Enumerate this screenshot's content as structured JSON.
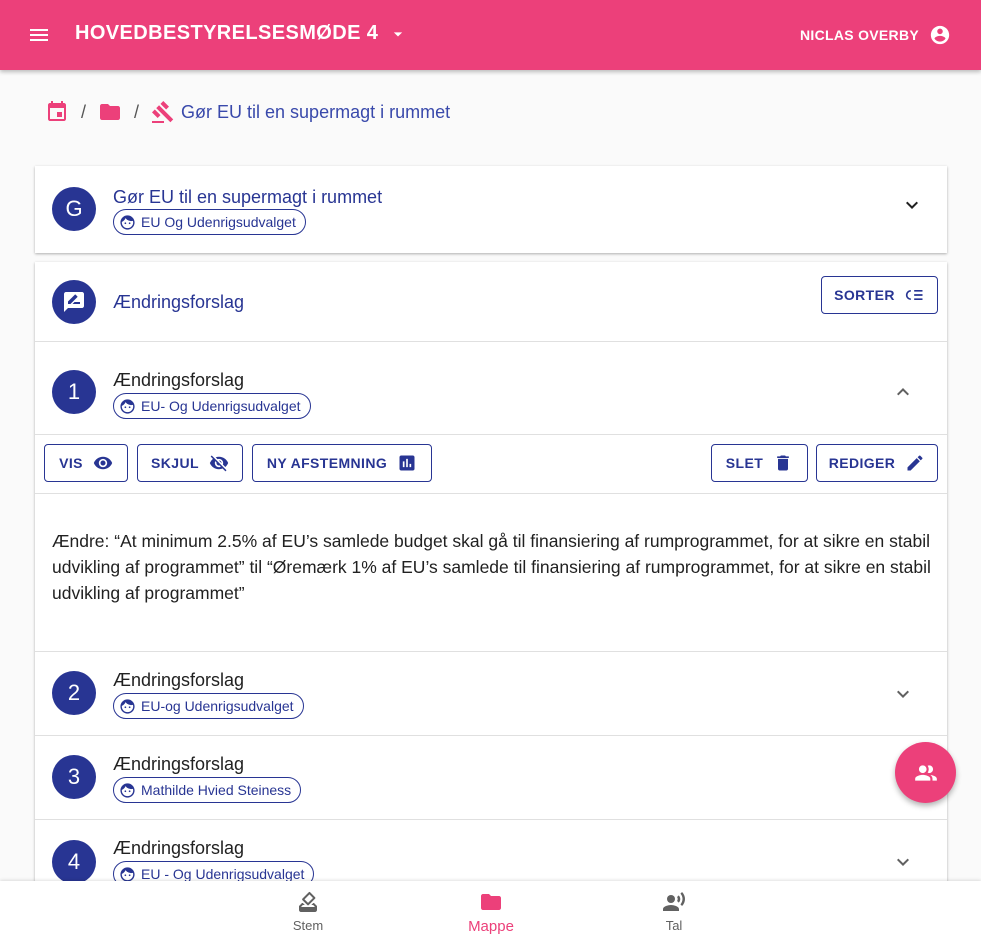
{
  "appbar": {
    "title": "HOVEDBESTYRELSESMØDE 4",
    "user": "NICLAS OVERBY"
  },
  "breadcrumb": {
    "current": "Gør EU til en supermagt i rummet"
  },
  "agenda_item": {
    "avatar_letter": "G",
    "title": "Gør EU til en supermagt i rummet",
    "proposer": "EU Og Udenrigsudvalget"
  },
  "amendments_section": {
    "title": "Ændringsforslag",
    "sort_label": "SORTER"
  },
  "amendments": [
    {
      "number": "1",
      "title": "Ændringsforslag",
      "proposer": "EU- Og Udenrigsudvalget",
      "expanded": true,
      "actions": {
        "show": "VIS",
        "hide": "SKJUL",
        "new_vote": "NY AFSTEMNING",
        "delete": "SLET",
        "edit": "REDIGER"
      },
      "text": "Ændre: “At minimum 2.5% af EU’s samlede budget skal gå til finansiering af rumprogrammet, for at sikre en stabil udvikling af programmet” til “Øremærk 1% af EU’s samlede til finansiering af rumprogrammet, for at sikre en stabil udvikling af programmet”"
    },
    {
      "number": "2",
      "title": "Ændringsforslag",
      "proposer": "EU-og Udenrigsudvalget"
    },
    {
      "number": "3",
      "title": "Ændringsforslag",
      "proposer": "Mathilde Hvied Steiness"
    },
    {
      "number": "4",
      "title": "Ændringsforslag",
      "proposer": "EU - Og Udenrigsudvalget"
    }
  ],
  "bottom_nav": [
    {
      "label": "Stem",
      "icon": "ballot-box-icon",
      "active": false
    },
    {
      "label": "Mappe",
      "icon": "folder-icon",
      "active": true
    },
    {
      "label": "Tal",
      "icon": "speaker-icon",
      "active": false
    }
  ],
  "colors": {
    "primary": "#ec407a",
    "accent": "#283593"
  }
}
